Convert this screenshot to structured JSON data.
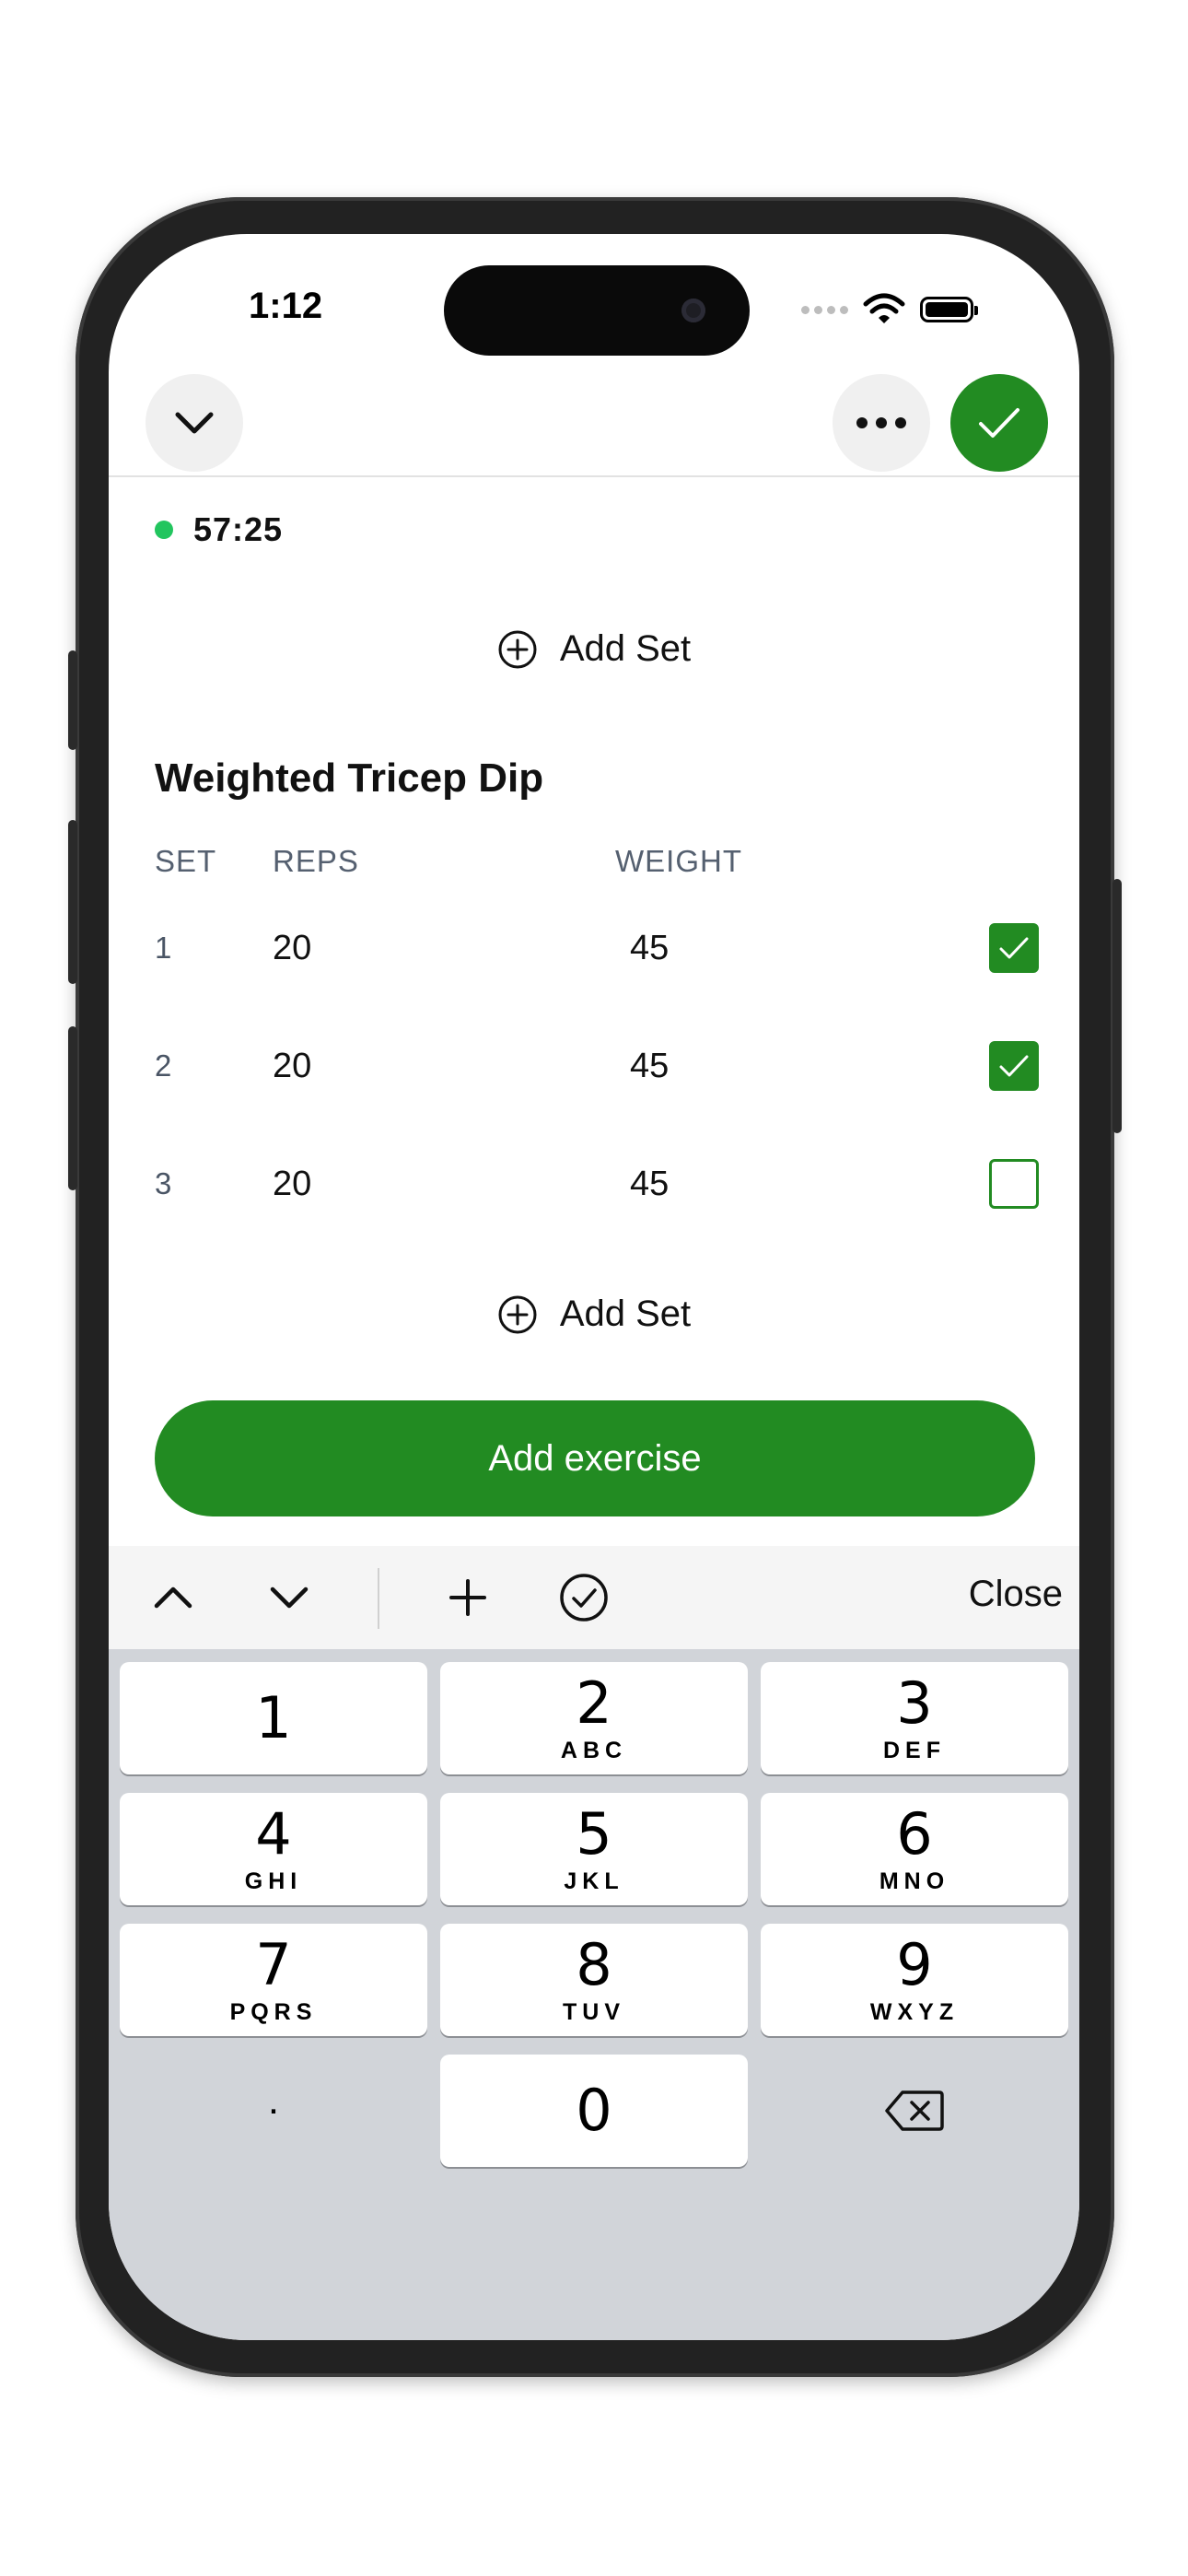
{
  "status_bar": {
    "time": "1:12"
  },
  "header": {
    "collapse_icon": "chevron-down-icon",
    "more_icon": "ellipsis-icon",
    "finish_icon": "checkmark-icon",
    "accent_color": "#228B22"
  },
  "timer": {
    "elapsed": "57:25",
    "indicator_color": "#22C55E"
  },
  "add_set_top": {
    "label": "Add Set",
    "icon": "plus-circle-icon"
  },
  "exercise": {
    "title": "Weighted Tricep Dip",
    "columns": {
      "set": "SET",
      "reps": "REPS",
      "weight": "WEIGHT"
    },
    "sets": [
      {
        "set": "1",
        "reps": "20",
        "weight": "45",
        "completed": true
      },
      {
        "set": "2",
        "reps": "20",
        "weight": "45",
        "completed": true
      },
      {
        "set": "3",
        "reps": "20",
        "weight": "45",
        "completed": false
      }
    ],
    "add_set_label": "Add Set"
  },
  "add_exercise_label": "Add exercise",
  "keyboard_toolbar": {
    "icons": [
      "chevron-up-icon",
      "chevron-down-icon",
      "plus-icon",
      "checkmark-circle-icon"
    ],
    "close_label": "Close"
  },
  "keypad": {
    "keys": [
      {
        "digit": "1",
        "letters": ""
      },
      {
        "digit": "2",
        "letters": "ABC"
      },
      {
        "digit": "3",
        "letters": "DEF"
      },
      {
        "digit": "4",
        "letters": "GHI"
      },
      {
        "digit": "5",
        "letters": "JKL"
      },
      {
        "digit": "6",
        "letters": "MNO"
      },
      {
        "digit": "7",
        "letters": "PQRS"
      },
      {
        "digit": "8",
        "letters": "TUV"
      },
      {
        "digit": "9",
        "letters": "WXYZ"
      }
    ],
    "decimal": ".",
    "zero": "0",
    "delete_icon": "backspace-icon"
  }
}
